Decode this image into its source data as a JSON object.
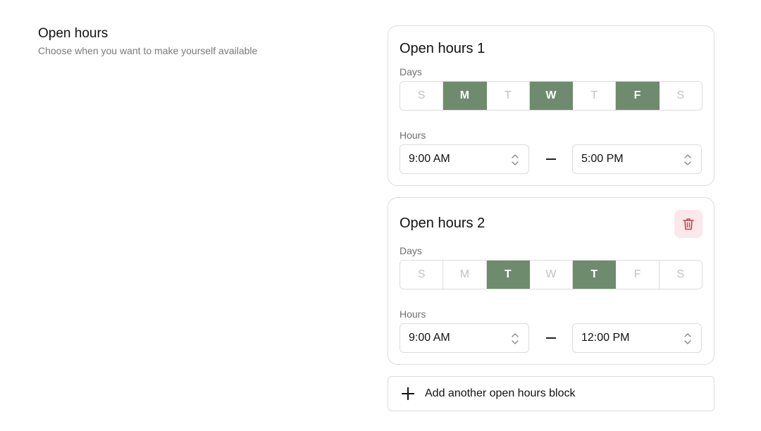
{
  "section": {
    "title": "Open hours",
    "subtitle": "Choose when you want to make yourself available"
  },
  "blocks": [
    {
      "title": "Open hours 1",
      "days_label": "Days",
      "days": [
        {
          "label": "S",
          "selected": false
        },
        {
          "label": "M",
          "selected": true
        },
        {
          "label": "T",
          "selected": false
        },
        {
          "label": "W",
          "selected": true
        },
        {
          "label": "T",
          "selected": false
        },
        {
          "label": "F",
          "selected": true
        },
        {
          "label": "S",
          "selected": false
        }
      ],
      "hours_label": "Hours",
      "start": "9:00 AM",
      "end": "5:00 PM"
    },
    {
      "title": "Open hours 2",
      "days_label": "Days",
      "days": [
        {
          "label": "S",
          "selected": false
        },
        {
          "label": "M",
          "selected": false
        },
        {
          "label": "T",
          "selected": true
        },
        {
          "label": "W",
          "selected": false
        },
        {
          "label": "T",
          "selected": true
        },
        {
          "label": "F",
          "selected": false
        },
        {
          "label": "S",
          "selected": false
        }
      ],
      "hours_label": "Hours",
      "start": "9:00 AM",
      "end": "12:00 PM",
      "delete_icon": "trash-icon"
    }
  ],
  "add_block": {
    "label": "Add another open hours block",
    "icon": "plus-icon"
  },
  "colors": {
    "selected_day": "#6e8b6e",
    "delete_bg": "#fce8ea",
    "delete_icon": "#c9414f"
  }
}
